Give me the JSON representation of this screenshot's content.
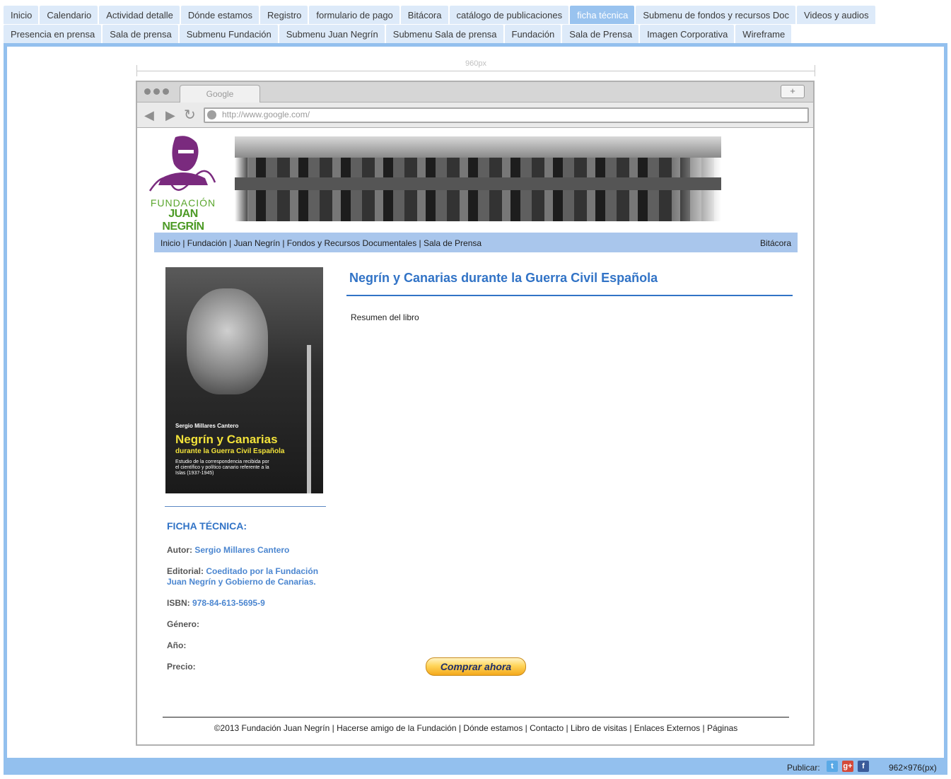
{
  "tabs_row1": [
    {
      "label": "Inicio"
    },
    {
      "label": "Calendario"
    },
    {
      "label": "Actividad detalle"
    },
    {
      "label": "Dónde estamos"
    },
    {
      "label": "Registro"
    },
    {
      "label": "formulario de pago"
    },
    {
      "label": "Bitácora"
    },
    {
      "label": "catálogo de publicaciones"
    },
    {
      "label": "ficha técnica",
      "active": true
    },
    {
      "label": "Submenu de fondos y recursos Doc"
    },
    {
      "label": "Videos y audios"
    }
  ],
  "tabs_row2": [
    {
      "label": "Presencia en prensa"
    },
    {
      "label": "Sala de prensa"
    },
    {
      "label": "Submenu Fundación"
    },
    {
      "label": "Submenu Juan Negrín"
    },
    {
      "label": "Submenu Sala de prensa"
    },
    {
      "label": "Fundación"
    },
    {
      "label": "Sala de Prensa"
    },
    {
      "label": "Imagen Corporativa"
    },
    {
      "label": "Wireframe"
    }
  ],
  "ruler": {
    "label": "960px"
  },
  "browser": {
    "tab_label": "Google",
    "plus": "+",
    "url": "http://www.google.com/"
  },
  "site": {
    "logo_signature": "J. Negrín",
    "logo_line1": "FUNDACIÓN",
    "logo_line2": "JUAN NEGRÍN",
    "menu_left": "Inicio | Fundación | Juan Negrín | Fondos y Recursos Documentales | Sala de Prensa",
    "menu_right": "Bitácora",
    "cover": {
      "author": "Sergio Millares Cantero",
      "title1": "Negrín y Canarias",
      "title2": "durante la Guerra Civil Española",
      "desc": "Estudio de la correspondencia recibida por el científico y político canario referente a la Islas (1937-1945)"
    },
    "ficha_heading": "FICHA TÉCNICA:",
    "specs": {
      "autor_k": "Autor:",
      "autor_v": "Sergio Millares Cantero",
      "editorial_k": "Editorial:",
      "editorial_v": "Coeditado por la Fundación Juan Negrín y Gobierno de Canarias.",
      "isbn_k": "ISBN:",
      "isbn_v": "978-84-613-5695-9",
      "genero_k": "Género:",
      "anio_k": "Año:",
      "precio_k": "Precio:"
    },
    "book_title": "Negrín y Canarias durante la Guerra Civil Española",
    "resumen": "Resumen del libro",
    "buy_label": "Comprar ahora",
    "footer": "©2013 Fundación Juan Negrín | Hacerse amigo de la Fundación | Dónde estamos | Contacto | Libro de visitas | Enlaces Externos | Páginas"
  },
  "statusbar": {
    "publicar": "Publicar:",
    "twitter": "t",
    "gplus": "g+",
    "facebook": "f",
    "dims": "962×976(px)"
  },
  "colors": {
    "accent": "#3173c6",
    "frame": "#93c0ee",
    "menubar": "#a9c6ec",
    "tab": "#ddeaf9",
    "tab_active": "#99c3ef"
  }
}
